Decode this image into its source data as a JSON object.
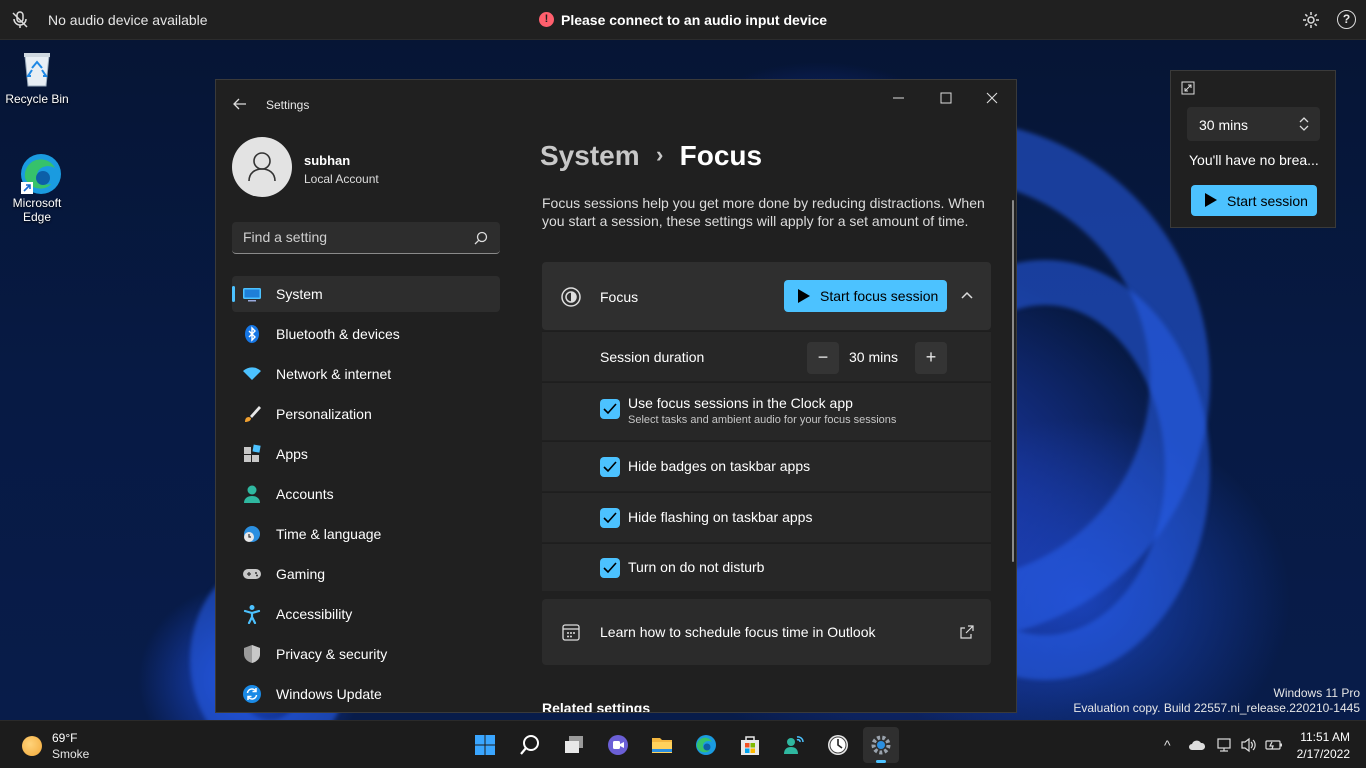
{
  "notification_bar": {
    "audio_status": "No audio device available",
    "warning_message": "Please connect to an audio input device",
    "warning_glyph": "!",
    "help_glyph": "?"
  },
  "desktop": {
    "icons": [
      {
        "label": "Recycle Bin"
      },
      {
        "label": "Microsoft Edge"
      }
    ]
  },
  "settings_window": {
    "title": "Settings",
    "user": {
      "name": "subhan",
      "account_type": "Local Account"
    },
    "search": {
      "placeholder": "Find a setting"
    },
    "nav": [
      {
        "label": "System",
        "icon": "system-icon",
        "active": true
      },
      {
        "label": "Bluetooth & devices",
        "icon": "bluetooth-icon"
      },
      {
        "label": "Network & internet",
        "icon": "wifi-icon"
      },
      {
        "label": "Personalization",
        "icon": "brush-icon"
      },
      {
        "label": "Apps",
        "icon": "apps-icon"
      },
      {
        "label": "Accounts",
        "icon": "accounts-icon"
      },
      {
        "label": "Time & language",
        "icon": "globe-clock-icon"
      },
      {
        "label": "Gaming",
        "icon": "gamepad-icon"
      },
      {
        "label": "Accessibility",
        "icon": "accessibility-icon"
      },
      {
        "label": "Privacy & security",
        "icon": "shield-icon"
      },
      {
        "label": "Windows Update",
        "icon": "update-icon"
      }
    ],
    "breadcrumb": {
      "parent": "System",
      "separator": "›",
      "current": "Focus"
    },
    "description": "Focus sessions help you get more done by reducing distractions. When you start a session, these settings will apply for a set amount of time.",
    "focus": {
      "label": "Focus",
      "start_button": "Start focus session",
      "session_duration_label": "Session duration",
      "duration_value": "30 mins",
      "minus": "−",
      "plus": "+",
      "options": [
        {
          "label": "Use focus sessions in the Clock app",
          "sublabel": "Select tasks and ambient audio for your focus sessions",
          "checked": true
        },
        {
          "label": "Hide badges on taskbar apps",
          "checked": true
        },
        {
          "label": "Hide flashing on taskbar apps",
          "checked": true
        },
        {
          "label": "Turn on do not disturb",
          "checked": true
        }
      ]
    },
    "outlook_link": "Learn how to schedule focus time in Outlook",
    "related_settings": "Related settings"
  },
  "clock_widget": {
    "duration": "30 mins",
    "message": "You'll have no brea...",
    "start_button": "Start session"
  },
  "watermark": {
    "edition": "Windows 11 Pro",
    "build": "Evaluation copy. Build 22557.ni_release.220210-1445"
  },
  "taskbar": {
    "weather": {
      "temp": "69°F",
      "condition": "Smoke"
    },
    "apps": [
      "start-icon",
      "search-icon",
      "task-view-icon",
      "chat-icon",
      "file-explorer-icon",
      "edge-icon",
      "store-icon",
      "people-icon",
      "clock-app-icon",
      "settings-icon"
    ],
    "tray_glyph": "^",
    "time": "11:51 AM",
    "date": "2/17/2022"
  },
  "colors": {
    "accent": "#4cc2ff",
    "window_bg": "#202020",
    "card_bg": "#2b2b2b",
    "taskbar_bg": "#1c1c1c"
  }
}
